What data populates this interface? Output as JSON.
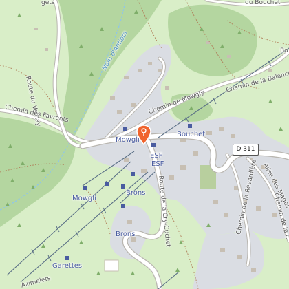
{
  "map": {
    "colors": {
      "meadow": "#d9eec8",
      "forest": "#b4d6a0",
      "builtup": "#dadde3",
      "road": "#ffffff",
      "road_casing": "#b9b6b0",
      "path": "#b07f5a",
      "lift": "#5a6f86",
      "stream": "#8ec5ea",
      "marker": "#f0642d",
      "stop": "#4a5ca0"
    },
    "labels": {
      "route_du_vernay": "Route du Vernay",
      "nom_dantiom": "Nom d'Antiom",
      "chemin_de_mowgly": "Chemin de Mowgly",
      "chemin_des_favrents": "Chemin des Favrents",
      "chemin_de_la_balanciere": "Chemin de la Balancière",
      "du_bouchet": "du Bouchet",
      "bo": "Bo",
      "bouchet": "Bouchet",
      "mowgli_top": "Mowgli",
      "esf_1": "ESF",
      "esf_2": "ESF",
      "mowgli": "Mowgli",
      "brons_1": "Brons",
      "brons_2": "Brons",
      "route_de_la_cry_cuchet": "Route de la Cry-Cuchet",
      "chemin_de_la_revardiere": "Chemin de la Revardière",
      "allee_des_mages": "Allée des Mages",
      "chemin_de_la_c": "Chemin de la C",
      "garettes": "Garettes",
      "azimelets": "Azimelets",
      "gets": "gets",
      "road_ref": "D 311"
    },
    "icons": {
      "marker": "map-pin-icon",
      "stop": "bus-stop-icon",
      "tree": "tree-icon"
    }
  }
}
